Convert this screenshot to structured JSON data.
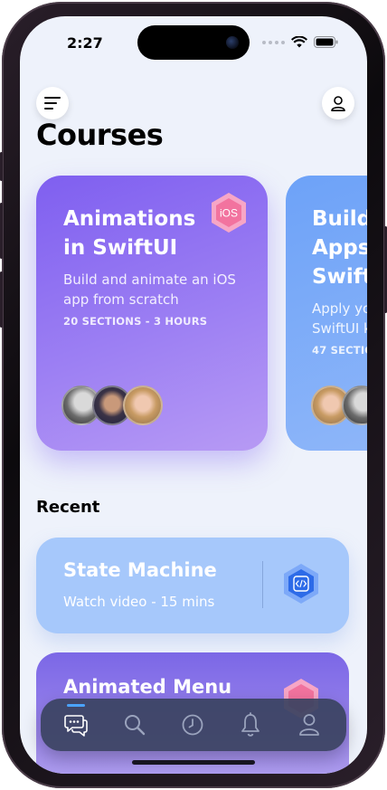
{
  "status_bar": {
    "time": "2:27"
  },
  "header": {
    "title": "Courses",
    "menu_icon": "hamburger-icon",
    "profile_icon": "person-icon"
  },
  "courses": [
    {
      "title": "Animations\nin SwiftUI",
      "subtitle": "Build and animate an iOS\napp from scratch",
      "meta": "20 SECTIONS - 3 HOURS",
      "badge": "iOS"
    },
    {
      "title": "Build\nApps\nSwift",
      "subtitle": "Apply yo\nSwiftUI k",
      "meta": "47 SECTIO"
    }
  ],
  "recent": {
    "heading": "Recent",
    "items": [
      {
        "title": "State Machine",
        "subtitle": "Watch video - 15 mins",
        "icon": "code-icon"
      },
      {
        "title": "Animated Menu",
        "icon": "ios-icon"
      }
    ]
  },
  "tabbar": {
    "items": [
      "chat-icon",
      "search-icon",
      "clock-icon",
      "bell-icon",
      "person-icon"
    ],
    "active": 0
  },
  "colors": {
    "card_purple": "#7f5ff0",
    "card_blue": "#6da2f8",
    "recent_blue": "#a6c8fb",
    "tab_active": "#4aa3ff"
  }
}
